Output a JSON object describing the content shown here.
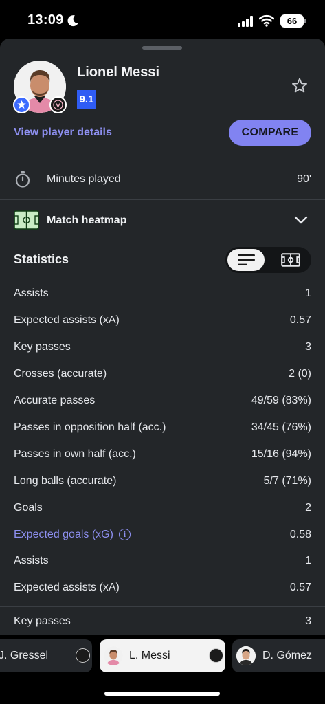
{
  "status_bar": {
    "time": "13:09",
    "battery": "66"
  },
  "player": {
    "name": "Lionel Messi",
    "rating": "9.1",
    "view_details": "View player details",
    "compare": "COMPARE"
  },
  "minutes": {
    "label": "Minutes played",
    "value": "90'"
  },
  "heatmap": {
    "label": "Match heatmap"
  },
  "statistics": {
    "title": "Statistics",
    "rows": [
      {
        "label": "Assists",
        "value": "1"
      },
      {
        "label": "Expected assists (xA)",
        "value": "0.57"
      },
      {
        "label": "Key passes",
        "value": "3"
      },
      {
        "label": "Crosses (accurate)",
        "value": "2 (0)"
      },
      {
        "label": "Accurate passes",
        "value": "49/59 (83%)"
      },
      {
        "label": "Passes in opposition half (acc.)",
        "value": "34/45 (76%)"
      },
      {
        "label": "Passes in own half (acc.)",
        "value": "15/16 (94%)"
      },
      {
        "label": "Long balls (accurate)",
        "value": "5/7 (71%)"
      },
      {
        "label": "Goals",
        "value": "2"
      },
      {
        "label": "Expected goals (xG)",
        "value": "0.58",
        "info": "i"
      },
      {
        "label": "Assists",
        "value": "1"
      },
      {
        "label": "Expected assists (xA)",
        "value": "0.57"
      },
      {
        "label": "Key passes",
        "value": "3"
      }
    ]
  },
  "player_switcher": [
    "J. Gressel",
    "L. Messi",
    "D. Gómez"
  ],
  "colors": {
    "accent": "#8183f1",
    "link": "#8d8ff0",
    "rating": "#2f5cf4",
    "sheet": "#232629"
  },
  "icons": [
    "moon-icon",
    "signal-icon",
    "wifi-icon",
    "favorite-star-icon",
    "stopwatch-icon",
    "pitch-icon",
    "chevron-down-icon",
    "list-view-icon",
    "pitch-view-icon",
    "info-icon"
  ]
}
